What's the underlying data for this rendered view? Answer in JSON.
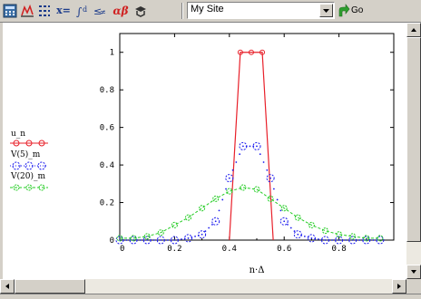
{
  "toolbar": {
    "icons": [
      "calculator-icon",
      "graph-icon",
      "matrix-icon",
      "evaluation-icon",
      "calculus-icon",
      "boolean-icon",
      "greek-icon",
      "symbolic-icon"
    ],
    "labels": {
      "evaluation": "x=",
      "greek": "αβ"
    },
    "site_select_value": "My Site",
    "go_label": "Go"
  },
  "colors": {
    "series_u": "#e8202a",
    "series_v5": "#1a1aee",
    "series_v20": "#22cc22",
    "axis": "#000000"
  },
  "chart_data": {
    "type": "line",
    "xlabel": "n·Δ",
    "xlim": [
      0,
      1
    ],
    "ylim": [
      0,
      1.1
    ],
    "x_ticks": [
      "0",
      "0.2",
      "0.4",
      "0.6",
      "0.8"
    ],
    "y_ticks": [
      "0",
      "0.2",
      "0.4",
      "0.6",
      "0.8",
      "1"
    ],
    "legend_placement": "left",
    "series": [
      {
        "name": "u_n",
        "style": "line-with-circles",
        "x": [
          0.4,
          0.44,
          0.48,
          0.52,
          0.56
        ],
        "y": [
          0,
          1,
          1,
          1,
          0
        ]
      },
      {
        "name": "V(5)_m",
        "style": "dots-with-circles",
        "x": [
          0.0,
          0.05,
          0.1,
          0.15,
          0.2,
          0.25,
          0.3,
          0.35,
          0.4,
          0.45,
          0.5,
          0.55,
          0.6,
          0.65,
          0.7,
          0.75,
          0.8,
          0.85,
          0.9,
          0.95
        ],
        "y": [
          0.0,
          0.0,
          0.0,
          0.0,
          0.0,
          0.01,
          0.03,
          0.1,
          0.33,
          0.5,
          0.5,
          0.33,
          0.1,
          0.03,
          0.01,
          0.0,
          0.0,
          0.0,
          0.0,
          0.0
        ]
      },
      {
        "name": "V(20)_m",
        "style": "dashed-with-circles",
        "x": [
          0.0,
          0.05,
          0.1,
          0.15,
          0.2,
          0.25,
          0.3,
          0.35,
          0.4,
          0.45,
          0.5,
          0.55,
          0.6,
          0.65,
          0.7,
          0.75,
          0.8,
          0.85,
          0.9,
          0.95
        ],
        "y": [
          0.01,
          0.01,
          0.02,
          0.04,
          0.08,
          0.12,
          0.17,
          0.22,
          0.26,
          0.28,
          0.27,
          0.22,
          0.17,
          0.12,
          0.08,
          0.05,
          0.03,
          0.02,
          0.01,
          0.01
        ]
      }
    ]
  }
}
